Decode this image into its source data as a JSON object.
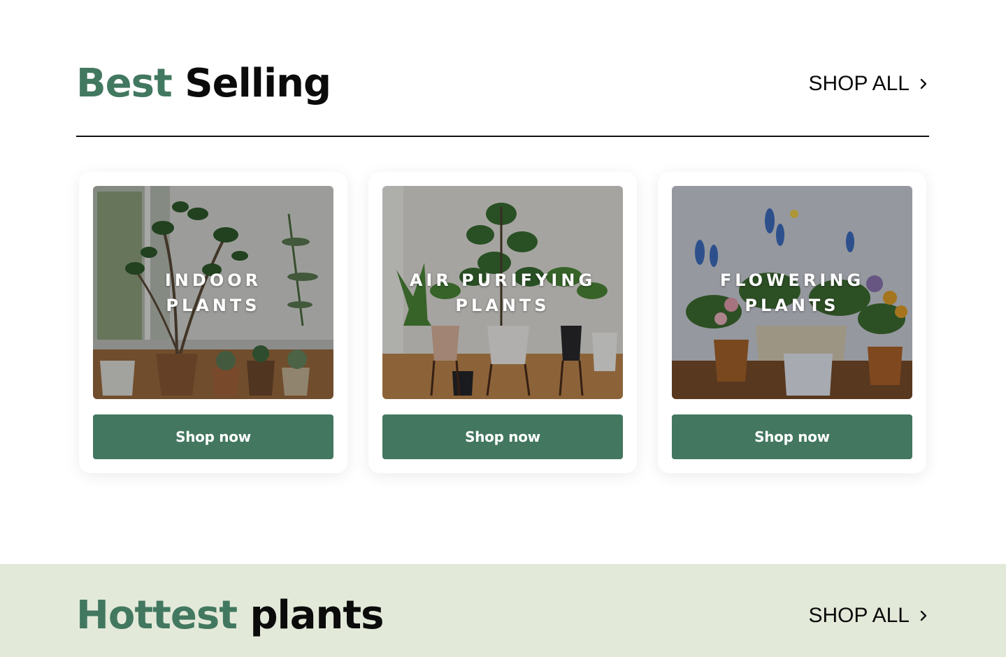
{
  "best_selling": {
    "title_accent": "Best",
    "title_rest": "Selling",
    "shop_all_label": "SHOP ALL",
    "cards": [
      {
        "label_line1": "INDOOR",
        "label_line2": "PLANTS",
        "button_label": "Shop now"
      },
      {
        "label_line1": "AIR PURIFYING",
        "label_line2": "PLANTS",
        "button_label": "Shop now"
      },
      {
        "label_line1": "FLOWERING",
        "label_line2": "PLANTS",
        "button_label": "Shop now"
      }
    ]
  },
  "hottest": {
    "title_accent": "Hottest",
    "title_rest": "plants",
    "shop_all_label": "SHOP ALL"
  },
  "colors": {
    "accent": "#427860",
    "button": "#437760",
    "band": "#e3e9d9",
    "text": "#0b0b0b"
  },
  "icons": {
    "shop_all": "chevron-right-icon"
  }
}
